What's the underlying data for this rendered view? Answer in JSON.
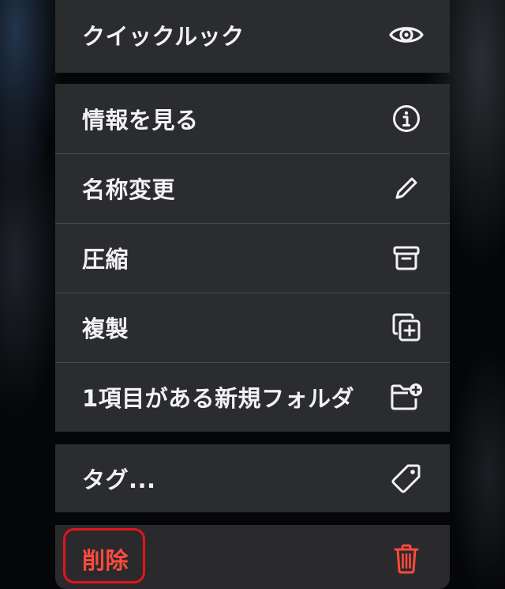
{
  "colors": {
    "menu_background": "#2b2c2e",
    "text": "#f2f2f4",
    "destructive": "#ff4a3d",
    "highlight": "#e0151b"
  },
  "menu": {
    "quick_look": {
      "label": "クイックルック",
      "icon": "eye-icon"
    },
    "get_info": {
      "label": "情報を見る",
      "icon": "info-circle-icon"
    },
    "rename": {
      "label": "名称変更",
      "icon": "pencil-icon"
    },
    "compress": {
      "label": "圧縮",
      "icon": "archive-box-icon"
    },
    "duplicate": {
      "label": "複製",
      "icon": "duplicate-plus-icon"
    },
    "new_folder": {
      "label": "1項目がある新規フォルダ",
      "icon": "folder-plus-icon"
    },
    "tags": {
      "label": "タグ...",
      "icon": "tag-icon"
    },
    "delete": {
      "label": "削除",
      "icon": "trash-icon"
    }
  }
}
